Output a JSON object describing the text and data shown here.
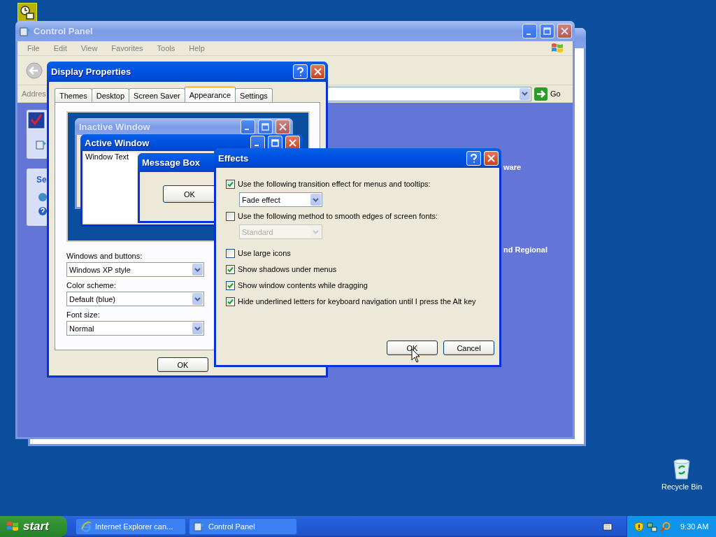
{
  "desktop": {
    "icons": [
      {
        "label": "Recycle Bin"
      }
    ]
  },
  "control_panel": {
    "title": "Control Panel",
    "menu": [
      "File",
      "Edit",
      "View",
      "Favorites",
      "Tools",
      "Help"
    ],
    "address_label": "Addres",
    "go_label": "Go",
    "sidebar_heading": "Se",
    "category_texts": [
      "ware",
      "nd Regional"
    ]
  },
  "display_properties": {
    "title": "Display Properties",
    "tabs": [
      {
        "label": "Themes",
        "selected": false
      },
      {
        "label": "Desktop",
        "selected": false
      },
      {
        "label": "Screen Saver",
        "selected": false
      },
      {
        "label": "Appearance",
        "selected": true
      },
      {
        "label": "Settings",
        "selected": false
      }
    ],
    "preview": {
      "inactive_title": "Inactive Window",
      "active_title": "Active Window",
      "window_text": "Window Text",
      "message_title": "Message Box",
      "ok_label": "OK"
    },
    "fields": [
      {
        "label": "Windows and buttons:",
        "value": "Windows XP style"
      },
      {
        "label": "Color scheme:",
        "value": "Default (blue)"
      },
      {
        "label": "Font size:",
        "value": "Normal"
      }
    ],
    "buttons": [
      "OK"
    ]
  },
  "effects": {
    "title": "Effects",
    "options": [
      {
        "kind": "checkbox",
        "label": "Use the following transition effect for menus and tooltips:",
        "checked": true
      },
      {
        "kind": "dropdown",
        "value": "Fade effect",
        "disabled": false
      },
      {
        "kind": "checkbox",
        "label": "Use the following method to smooth edges of screen fonts:",
        "checked": false
      },
      {
        "kind": "dropdown",
        "value": "Standard",
        "disabled": true
      },
      {
        "kind": "checkbox",
        "label": "Use large icons",
        "checked": false
      },
      {
        "kind": "checkbox",
        "label": "Show shadows under menus",
        "checked": true
      },
      {
        "kind": "checkbox",
        "label": "Show window contents while dragging",
        "checked": true
      },
      {
        "kind": "checkbox",
        "label": "Hide underlined letters for keyboard navigation until I press the Alt key",
        "checked": true
      }
    ],
    "buttons": [
      "OK",
      "Cancel"
    ]
  },
  "taskbar": {
    "start_label": "start",
    "tasks": [
      {
        "label": "Internet Explorer can..."
      },
      {
        "label": "Control Panel"
      }
    ],
    "clock": "9:30 AM"
  }
}
